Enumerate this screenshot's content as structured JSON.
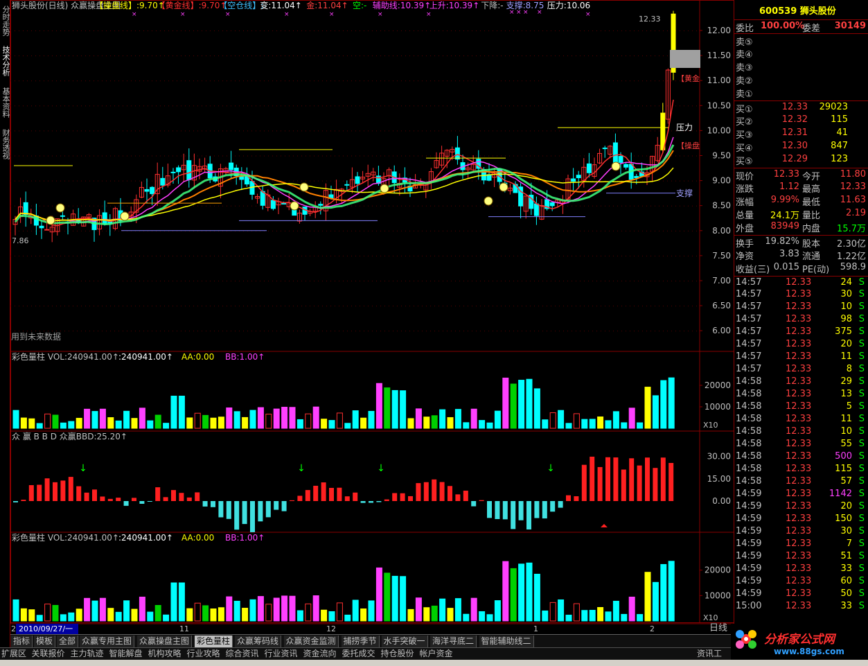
{
  "left_tabs": [
    "分时走势",
    "技术分析",
    "基本资料",
    "财务透视"
  ],
  "main_chart": {
    "header": [
      {
        "t": "狮头股份(日线) 众赢操盘主图",
        "c": "#c0c0c0"
      },
      {
        "t": "【操盘线】:9.70↑",
        "c": "#ffff00"
      },
      {
        "t": "【黄金线】:9.70↑",
        "c": "#ff3030"
      },
      {
        "t": "【空仓线】:-",
        "c": "#40c0ff"
      },
      {
        "t": "变:11.04↑",
        "c": "#ffffff"
      },
      {
        "t": "金:11.04↑",
        "c": "#ff4040"
      },
      {
        "t": "空:-",
        "c": "#00ff00"
      },
      {
        "t": "辅助线:10.39↑",
        "c": "#ff40ff"
      },
      {
        "t": "上升:10.39↑",
        "c": "#ff40ff"
      },
      {
        "t": "下降:-",
        "c": "#c0c0c0"
      },
      {
        "t": "支撑:8.75",
        "c": "#a0a0ff"
      },
      {
        "t": "压力:10.06",
        "c": "#ffffff"
      }
    ],
    "ylabels": [
      "12.00",
      "11.50",
      "11.00",
      "10.50",
      "10.00",
      "9.50",
      "9.00",
      "8.50",
      "8.00",
      "7.50",
      "7.00",
      "6.50",
      "6.00"
    ],
    "label_high": "12.33",
    "label_low": "7.86",
    "label_pressure": "压力",
    "label_support": "支撑",
    "label_cpx": "【操盘",
    "label_hj": "【黄金",
    "note": "用到未来数据"
  },
  "vol1": {
    "header": [
      {
        "t": "彩色量柱  VOL:240941.00↑",
        "c": "#c0c0c0"
      },
      {
        "t": ":240941.00↑",
        "c": "#ffffff"
      },
      {
        "t": "AA:0.00",
        "c": "#ffff00"
      },
      {
        "t": "BB:1.00↑",
        "c": "#ff40ff"
      }
    ],
    "ylabels": [
      "20000",
      "10000"
    ],
    "unit": "X10"
  },
  "bbd": {
    "header": [
      {
        "t": "众 赢 B B D  众赢BBD:25.20↑",
        "c": "#c0c0c0"
      }
    ],
    "ylabels": [
      "30.00",
      "15.00",
      "0.00"
    ]
  },
  "vol2": {
    "header": [
      {
        "t": "彩色量柱  VOL:240941.00↑",
        "c": "#c0c0c0"
      },
      {
        "t": ":240941.00↑",
        "c": "#ffffff"
      },
      {
        "t": "AA:0.00",
        "c": "#ffff00"
      },
      {
        "t": "BB:1.00↑",
        "c": "#ff40ff"
      }
    ],
    "ylabels": [
      "20000",
      "10000"
    ],
    "unit": "X10"
  },
  "date_axis": {
    "cursor_date": "2010/09/27/一",
    "months": [
      "11",
      "12",
      "1",
      "2"
    ],
    "pre": "2"
  },
  "right_panel": {
    "code": "600539",
    "name": "狮头股份",
    "weibi_label": "委比",
    "weibi": "100.00%",
    "weicha_label": "委差",
    "weicha": "30149",
    "asks": [
      {
        "l": "卖⑤"
      },
      {
        "l": "卖④"
      },
      {
        "l": "卖③"
      },
      {
        "l": "卖②"
      },
      {
        "l": "卖①"
      }
    ],
    "bids": [
      {
        "l": "买①",
        "p": "12.33",
        "v": "29023"
      },
      {
        "l": "买②",
        "p": "12.32",
        "v": "115"
      },
      {
        "l": "买③",
        "p": "12.31",
        "v": "41"
      },
      {
        "l": "买④",
        "p": "12.30",
        "v": "847"
      },
      {
        "l": "买⑤",
        "p": "12.29",
        "v": "123"
      }
    ],
    "quote": [
      {
        "l1": "现价",
        "v1": "12.33",
        "c1": "#ff4040",
        "l2": "今开",
        "v2": "11.80",
        "c2": "#ff4040"
      },
      {
        "l1": "涨跌",
        "v1": "1.12",
        "c1": "#ff4040",
        "l2": "最高",
        "v2": "12.33",
        "c2": "#ff4040"
      },
      {
        "l1": "涨幅",
        "v1": "9.99%",
        "c1": "#ff4040",
        "l2": "最低",
        "v2": "11.63",
        "c2": "#ff4040"
      },
      {
        "l1": "总量",
        "v1": "24.1万",
        "c1": "#ffff00",
        "l2": "量比",
        "v2": "2.19",
        "c2": "#ff4040"
      },
      {
        "l1": "外盘",
        "v1": "83949",
        "c1": "#ff4040",
        "l2": "内盘",
        "v2": "15.7万",
        "c2": "#00ff00"
      }
    ],
    "fin": [
      {
        "l1": "换手",
        "v1": "19.82%",
        "l2": "股本",
        "v2": "2.30亿"
      },
      {
        "l1": "净资",
        "v1": "3.83",
        "l2": "流通",
        "v2": "1.22亿"
      },
      {
        "l1": "收益(三)",
        "v1": "0.015",
        "l2": "PE(动)",
        "v2": "598.9"
      }
    ],
    "ticks": [
      {
        "t": "14:57",
        "p": "12.33",
        "v": "24",
        "s": "S"
      },
      {
        "t": "14:57",
        "p": "12.33",
        "v": "30",
        "s": "S"
      },
      {
        "t": "14:57",
        "p": "12.33",
        "v": "10",
        "s": "S"
      },
      {
        "t": "14:57",
        "p": "12.33",
        "v": "98",
        "s": "S"
      },
      {
        "t": "14:57",
        "p": "12.33",
        "v": "375",
        "s": "S"
      },
      {
        "t": "14:57",
        "p": "12.33",
        "v": "20",
        "s": "S"
      },
      {
        "t": "14:57",
        "p": "12.33",
        "v": "11",
        "s": "S"
      },
      {
        "t": "14:57",
        "p": "12.33",
        "v": "8",
        "s": "S"
      },
      {
        "t": "14:58",
        "p": "12.33",
        "v": "29",
        "s": "S"
      },
      {
        "t": "14:58",
        "p": "12.33",
        "v": "13",
        "s": "S"
      },
      {
        "t": "14:58",
        "p": "12.33",
        "v": "5",
        "s": "S"
      },
      {
        "t": "14:58",
        "p": "12.33",
        "v": "11",
        "s": "S"
      },
      {
        "t": "14:58",
        "p": "12.33",
        "v": "10",
        "s": "S"
      },
      {
        "t": "14:58",
        "p": "12.33",
        "v": "55",
        "s": "S"
      },
      {
        "t": "14:58",
        "p": "12.33",
        "v": "500",
        "s": "S"
      },
      {
        "t": "14:58",
        "p": "12.33",
        "v": "115",
        "s": "S"
      },
      {
        "t": "14:58",
        "p": "12.33",
        "v": "57",
        "s": "S"
      },
      {
        "t": "14:59",
        "p": "12.33",
        "v": "1142",
        "s": "S"
      },
      {
        "t": "14:59",
        "p": "12.33",
        "v": "20",
        "s": "S"
      },
      {
        "t": "14:59",
        "p": "12.33",
        "v": "150",
        "s": "S"
      },
      {
        "t": "14:59",
        "p": "12.33",
        "v": "30",
        "s": "S"
      },
      {
        "t": "14:59",
        "p": "12.33",
        "v": "7",
        "s": "S"
      },
      {
        "t": "14:59",
        "p": "12.33",
        "v": "51",
        "s": "S"
      },
      {
        "t": "14:59",
        "p": "12.33",
        "v": "33",
        "s": "S"
      },
      {
        "t": "14:59",
        "p": "12.33",
        "v": "60",
        "s": "S"
      },
      {
        "t": "14:59",
        "p": "12.33",
        "v": "50",
        "s": "S"
      },
      {
        "t": "15:00",
        "p": "12.33",
        "v": "33",
        "s": "S"
      }
    ]
  },
  "tabs_row1": [
    "指标",
    "模板",
    "全部",
    "众赢专用主图",
    "众赢操盘主图",
    "彩色量柱",
    "众赢筹码线",
    "众赢资金监测",
    "捕捞季节",
    "水手突破一",
    "海洋寻底二",
    "智能辅助线二"
  ],
  "daily_label": "日线",
  "tabs_row2": [
    "扩展区",
    "关联报价",
    "主力轨迹",
    "智能解盘",
    "机构攻略",
    "行业攻略",
    "综合资讯",
    "行业资讯",
    "资金流向",
    "委托成交",
    "持仓股份",
    "帐户资金",
    "资讯工",
    "分析家公式网",
    "www.88gs.com"
  ],
  "colors": {
    "up": "#ff3030",
    "down": "#00ffff",
    "vol_yellow": "#ffff00",
    "vol_green": "#00d000",
    "vol_blue": "#0040ff",
    "grid": "#8a0000",
    "bg": "#000000"
  }
}
